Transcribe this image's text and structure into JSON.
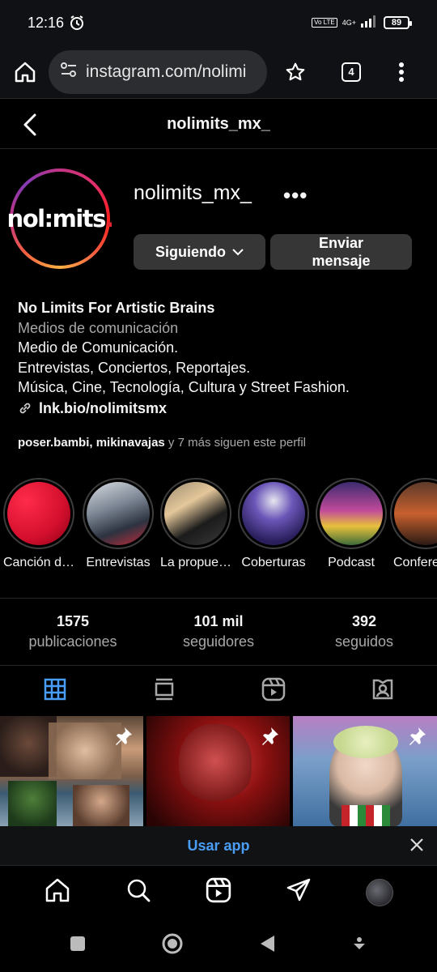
{
  "status_bar": {
    "time": "12:16",
    "volte": "Vo LTE",
    "network": "4G+",
    "battery": "89"
  },
  "browser": {
    "url": "instagram.com/nolimi",
    "tab_count": "4"
  },
  "page_header": {
    "title": "nolimits_mx_"
  },
  "profile": {
    "username": "nolimits_mx_",
    "avatar_logo": {
      "main": "nol:mits",
      "dot": "."
    },
    "more": "•••",
    "follow_button": "Siguiendo",
    "message_button": "Enviar mensaje",
    "bio": {
      "name": "No Limits For Artistic Brains",
      "category": "Medios de comunicación",
      "lines": [
        "Medio de Comunicación.",
        "Entrevistas, Conciertos, Reportajes.",
        "Música, Cine, Tecnología, Cultura y Street Fashion."
      ],
      "link": "lnk.bio/nolimitsmx"
    },
    "followed_by": {
      "names": "poser.bambi, mikinavajas",
      "rest": " y 7 más siguen este perfil"
    }
  },
  "highlights": [
    {
      "label": "Canción d…"
    },
    {
      "label": "Entrevistas"
    },
    {
      "label": "La propue…"
    },
    {
      "label": "Coberturas"
    },
    {
      "label": "Podcast"
    },
    {
      "label": "Confere"
    }
  ],
  "stats": [
    {
      "value": "1575",
      "label": "publicaciones"
    },
    {
      "value": "101 mil",
      "label": "seguidores"
    },
    {
      "value": "392",
      "label": "seguidos"
    }
  ],
  "tabs": [
    {
      "icon": "grid-icon",
      "active": true
    },
    {
      "icon": "feed-icon",
      "active": false
    },
    {
      "icon": "reels-icon",
      "active": false
    },
    {
      "icon": "tagged-icon",
      "active": false
    }
  ],
  "banner": {
    "label": "Usar app"
  },
  "colors": {
    "accent": "#4a9df5",
    "button_bg": "#363636",
    "background": "#000000"
  }
}
